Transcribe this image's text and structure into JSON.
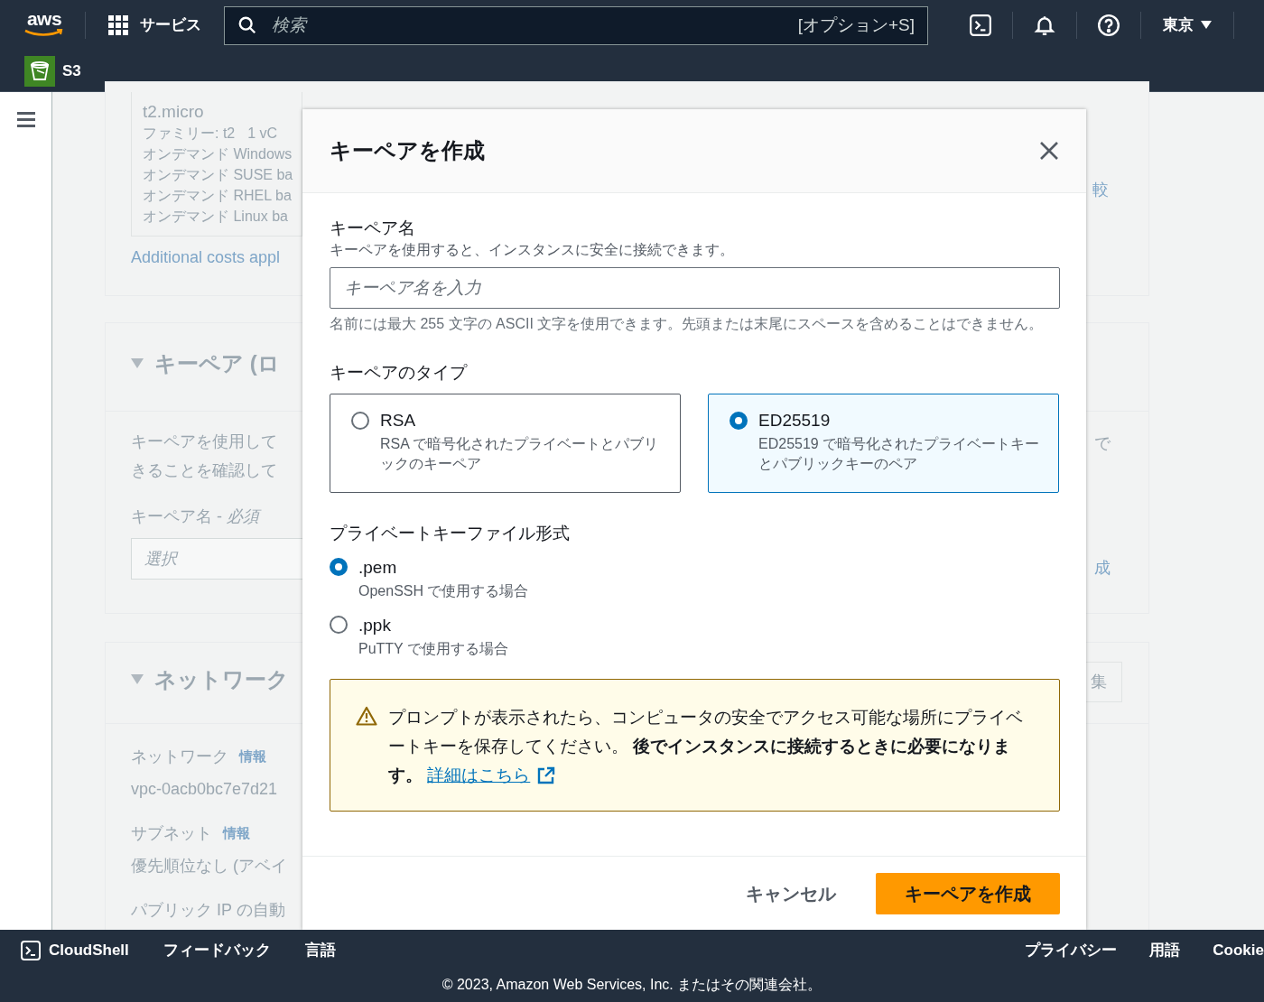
{
  "header": {
    "logo": "aws",
    "services_label": "サービス",
    "search": {
      "placeholder": "検索",
      "shortcut": "[オプション+S]"
    },
    "region": "東京",
    "service_tab": "S3"
  },
  "background": {
    "instance_box": [
      "t2.micro",
      "オンデマンド Windows",
      "オンデマンド SUSE ba",
      "オンデマンド RHEL ba",
      "オンデマンド Linux ba"
    ],
    "family": "ファミリー: t2",
    "vcpu": "1 vC",
    "costs_link": "Additional costs appl",
    "compare_fragment": "較",
    "keypair_section": {
      "title": "キーペア (ロ",
      "description": [
        "キーペアを使用して",
        "きることを確認して"
      ],
      "field_label": "キーペア名 - *必須*",
      "select_placeholder": "選択",
      "right_text": "で",
      "right_link": "成"
    },
    "network_section": {
      "title": "ネットワーク",
      "button_fragment": "集",
      "fields": [
        {
          "label": "ネットワーク",
          "info": "情報",
          "value": "vpc-0acb0bc7e7d21"
        },
        {
          "label": "サブネット",
          "info": "情報",
          "value": "優先順位なし (アベイ"
        },
        {
          "label": "パブリック IP の自動"
        }
      ]
    }
  },
  "dialog": {
    "title": "キーペアを作成",
    "name_label": "キーペア名",
    "name_description": "キーペアを使用すると、インスタンスに安全に接続できます。",
    "name_placeholder": "キーペア名を入力",
    "name_hint": "名前には最大 255 文字の ASCII 文字を使用できます。先頭または末尾にスペースを含めることはできません。",
    "type_label": "キーペアのタイプ",
    "types": [
      {
        "label": "RSA",
        "description": "RSA で暗号化されたプライベートとパブリックのキーペア",
        "selected": false
      },
      {
        "label": "ED25519",
        "description": "ED25519 で暗号化されたプライベートキーとパブリックキーのペア",
        "selected": true
      }
    ],
    "format_label": "プライベートキーファイル形式",
    "formats": [
      {
        "label": ".pem",
        "description": "OpenSSH で使用する場合",
        "selected": true
      },
      {
        "label": ".ppk",
        "description": "PuTTY で使用する場合",
        "selected": false
      }
    ],
    "warning": {
      "text": "プロンプトが表示されたら、コンピュータの安全でアクセス可能な場所にプライベートキーを保存してください。 **後でインスタンスに接続するときに必要になります。**",
      "link": "詳細はこちら"
    },
    "buttons": {
      "cancel": "キャンセル",
      "create": "キーペアを作成"
    }
  },
  "footer": {
    "left": [
      "CloudShell",
      "フィードバック",
      "言語"
    ],
    "right": [
      "プライバシー",
      "用語",
      "Cookie"
    ],
    "copyright": "© 2023, Amazon Web Services, Inc. またはその関連会社。"
  }
}
